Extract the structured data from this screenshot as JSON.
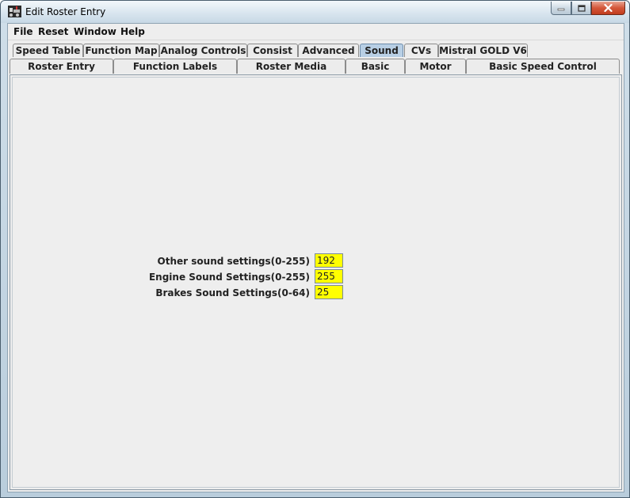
{
  "window": {
    "title": "Edit Roster Entry"
  },
  "menu": [
    "File",
    "Reset",
    "Window",
    "Help"
  ],
  "tabs": {
    "row1": [
      "Speed Table",
      "Function Map",
      "Analog Controls",
      "Consist",
      "Advanced",
      "Sound",
      "CVs",
      "Mistral GOLD V6"
    ],
    "row2": [
      "Roster Entry",
      "Function Labels",
      "Roster Media",
      "Basic",
      "Motor",
      "Basic Speed Control"
    ],
    "selected": "Sound"
  },
  "sound_settings": {
    "fields": [
      {
        "label": "Other sound settings(0-255)",
        "value": "192"
      },
      {
        "label": "Engine Sound Settings(0-255)",
        "value": "255"
      },
      {
        "label": "Brakes Sound Settings(0-64)",
        "value": "25"
      }
    ],
    "field_color": "#ffff00"
  }
}
